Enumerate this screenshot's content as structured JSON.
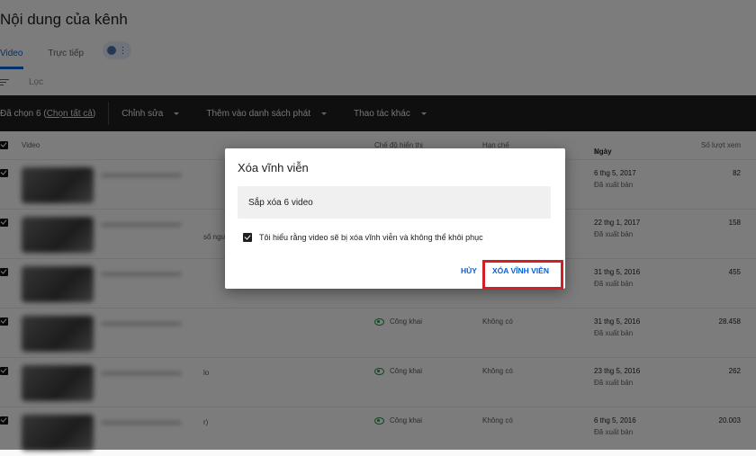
{
  "page": {
    "title": "Nội dung của kênh",
    "tabs": [
      {
        "label": "Video",
        "active": true
      },
      {
        "label": "Trực tiếp",
        "active": false
      }
    ],
    "filter_label": "Lọc"
  },
  "toolbar": {
    "selected_prefix": "Đã chọn 6 (",
    "select_all": "Chọn tất cả",
    "selected_suffix": ")",
    "edit": "Chỉnh sửa",
    "add_to_playlist": "Thêm vào danh sách phát",
    "more_actions": "Thao tác khác"
  },
  "table": {
    "headers": {
      "video": "Video",
      "visibility": "Chế độ hiển thị",
      "restrictions": "Hạn chế",
      "date": "Ngày",
      "views": "Số lượt xem"
    },
    "rows": [
      {
        "visibility": "",
        "restrictions": "",
        "date": "6 thg 5, 2017",
        "status": "Đã xuất bản",
        "views": "82",
        "frag": ""
      },
      {
        "visibility": "",
        "restrictions": "",
        "date": "22 thg 1, 2017",
        "status": "Đã xuất bản",
        "views": "158",
        "frag": "số ngư"
      },
      {
        "visibility": "",
        "restrictions": "",
        "date": "31 thg 5, 2016",
        "status": "Đã xuất bản",
        "views": "455",
        "frag": ""
      },
      {
        "visibility": "Công khai",
        "restrictions": "Không có",
        "date": "31 thg 5, 2016",
        "status": "Đã xuất bản",
        "views": "28.458",
        "frag": ""
      },
      {
        "visibility": "Công khai",
        "restrictions": "Không có",
        "date": "23 thg 5, 2016",
        "status": "Đã xuất bản",
        "views": "262",
        "frag": "lo"
      },
      {
        "visibility": "Công khai",
        "restrictions": "Không có",
        "date": "6 thg 5, 2016",
        "status": "Đã xuất bản",
        "views": "20.003",
        "frag": "r)"
      }
    ]
  },
  "dialog": {
    "title": "Xóa vĩnh viễn",
    "message": "Sắp xóa 6 video",
    "confirm_label": "Tôi hiểu rằng video sẽ bị xóa vĩnh viễn và không thể khôi phục",
    "cancel": "HỦY",
    "delete": "XÓA VĨNH VIỄN"
  },
  "colors": {
    "accent": "#065fd4",
    "highlight": "#d21f26",
    "public": "#1e8e3e"
  }
}
